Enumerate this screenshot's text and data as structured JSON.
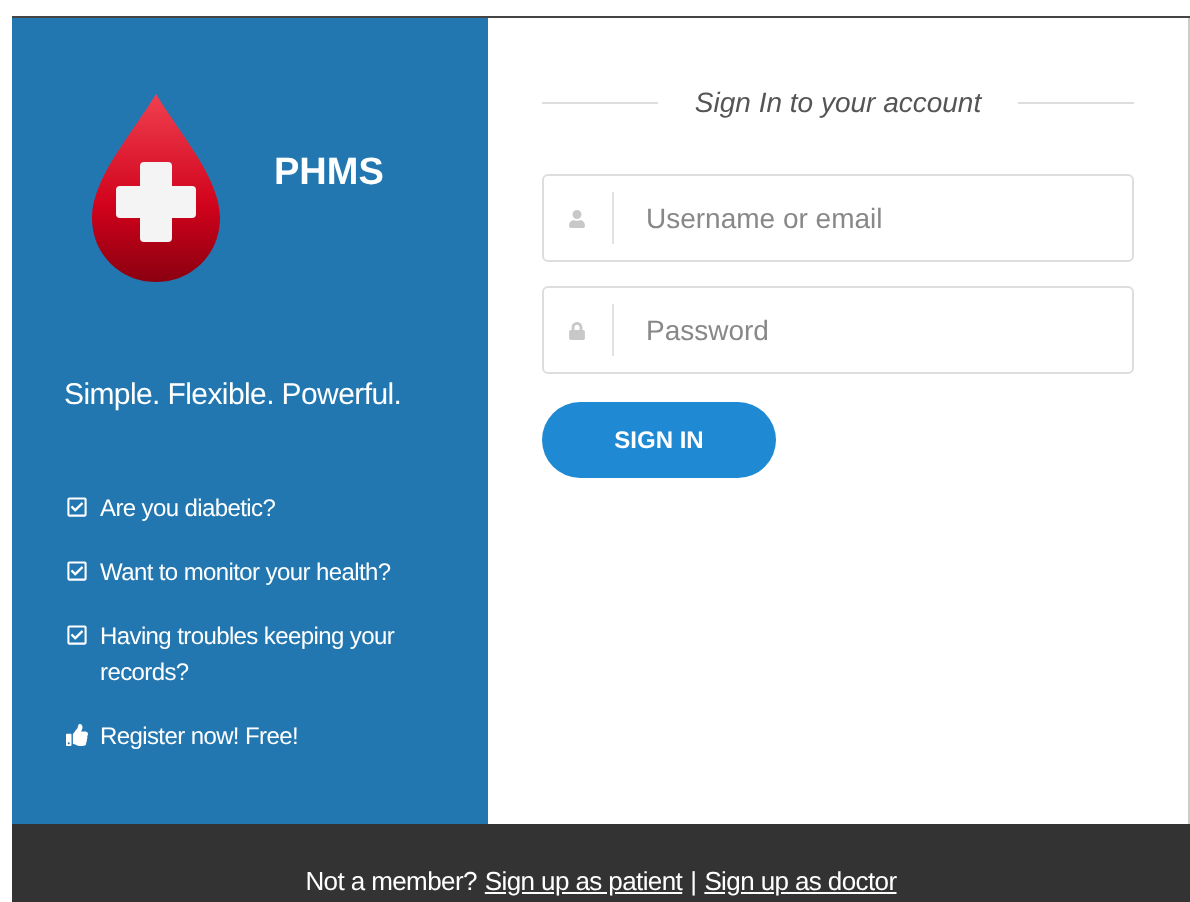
{
  "brand": {
    "name": "PHMS",
    "tagline": "Simple. Flexible. Powerful."
  },
  "features": [
    {
      "kind": "check",
      "text": "Are you diabetic?"
    },
    {
      "kind": "check",
      "text": "Want to monitor your health?"
    },
    {
      "kind": "check",
      "text": "Having troubles keeping your records?"
    },
    {
      "kind": "thumb",
      "text": "Register now! Free!"
    }
  ],
  "form": {
    "heading": "Sign In to your account",
    "fields": [
      {
        "kind": "user",
        "placeholder": "Username or email"
      },
      {
        "kind": "lock",
        "placeholder": "Password"
      }
    ],
    "button": "SIGN IN"
  },
  "footer": {
    "prompt": "Not a member?",
    "links": [
      "Sign up as patient",
      "Sign up as doctor"
    ],
    "separator": "|"
  }
}
